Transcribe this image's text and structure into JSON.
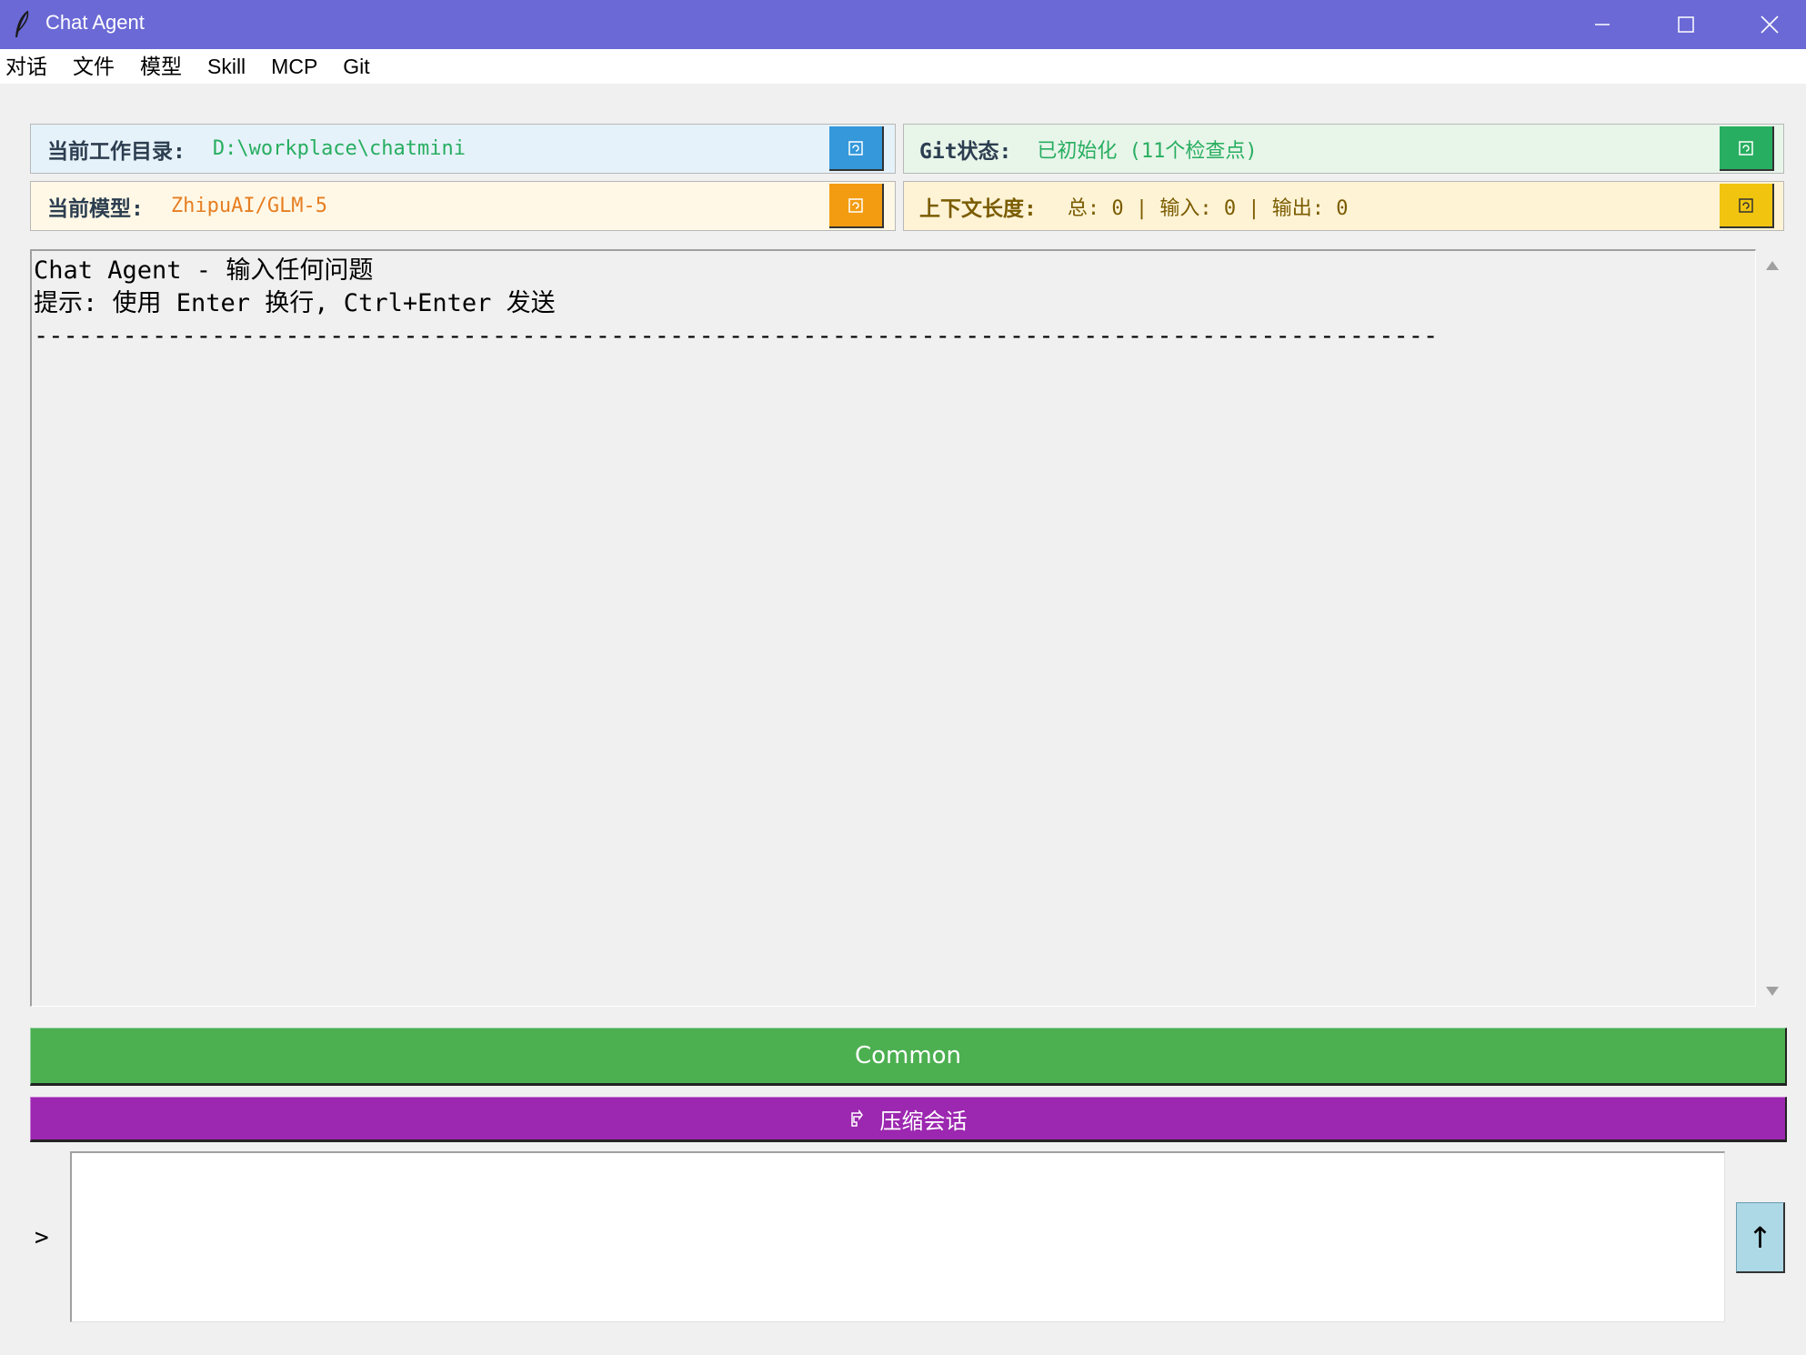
{
  "window": {
    "title": "Chat Agent",
    "accent_color": "#6b69d6",
    "icon": "feather-icon"
  },
  "menu": {
    "items": [
      {
        "label": "对话"
      },
      {
        "label": "文件"
      },
      {
        "label": "模型"
      },
      {
        "label": "Skill"
      },
      {
        "label": "MCP"
      },
      {
        "label": "Git"
      }
    ]
  },
  "info": {
    "workdir": {
      "label": "当前工作目录:",
      "value": "D:\\workplace\\chatmini",
      "button_color": "#3498db"
    },
    "git": {
      "label": "Git状态:",
      "value": "已初始化 (11个检查点)",
      "button_color": "#27ae60"
    },
    "model": {
      "label": "当前模型:",
      "value": "ZhipuAI/GLM-5",
      "button_color": "#f39c12"
    },
    "context": {
      "label": "上下文长度:",
      "value": "总: 0 | 输入: 0 | 输出: 0",
      "button_color": "#f1c40f"
    }
  },
  "chat": {
    "lines": [
      "Chat Agent - 输入任何问题",
      "提示: 使用 Enter 换行, Ctrl+Enter 发送",
      "-----------------------------------------------------------------------------------------------"
    ]
  },
  "buttons": {
    "common_label": "Common",
    "common_color": "#4caf50",
    "compress_label": "压缩会话",
    "compress_color": "#9c27b0",
    "send_label": "↑",
    "send_color": "#add8e6"
  },
  "input": {
    "prompt": ">",
    "value": ""
  }
}
